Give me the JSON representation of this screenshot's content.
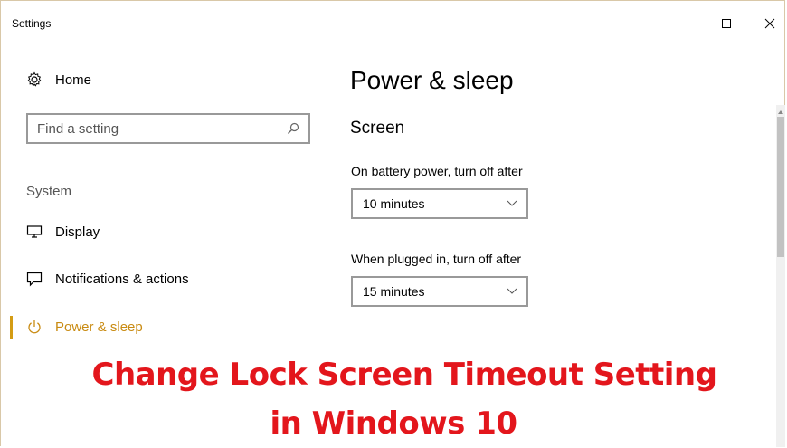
{
  "window": {
    "title": "Settings",
    "controls": {
      "minimize": "minimize",
      "maximize": "maximize",
      "close": "close"
    }
  },
  "sidebar": {
    "home_label": "Home",
    "search_placeholder": "Find a setting",
    "section_heading": "System",
    "items": [
      {
        "label": "Display",
        "icon": "monitor-icon"
      },
      {
        "label": "Notifications & actions",
        "icon": "notification-icon"
      },
      {
        "label": "Power & sleep",
        "icon": "power-icon",
        "active": true
      }
    ]
  },
  "main": {
    "title": "Power & sleep",
    "screen_heading": "Screen",
    "battery_label": "On battery power, turn off after",
    "battery_value": "10 minutes",
    "plugged_label": "When plugged in, turn off after",
    "plugged_value": "15 minutes"
  },
  "caption": {
    "line1": "Change Lock Screen Timeout Setting",
    "line2": "in Windows 10"
  },
  "colors": {
    "accent": "#d49c14",
    "caption": "#e3161c"
  }
}
